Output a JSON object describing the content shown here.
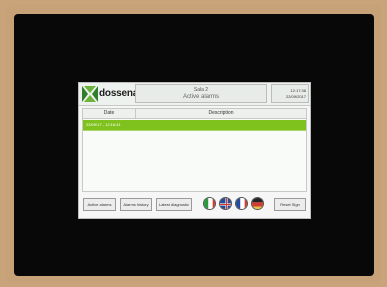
{
  "header": {
    "brand": "dossena",
    "room": "Sala 2",
    "page_title": "Active alarms",
    "time": "12:17:38",
    "date": "22/09/2017"
  },
  "table": {
    "columns": [
      "Date",
      "Description"
    ],
    "rows": [
      {
        "date": "22/09/17 - 12:16:41",
        "description": ""
      }
    ]
  },
  "footer": {
    "buttons": [
      "Active alarms",
      "Alarms history",
      "Latest diagnostic"
    ],
    "user_button": "Reset Sign"
  },
  "flags": [
    "italian-flag",
    "english-flag",
    "french-flag",
    "german-flag"
  ],
  "colors": {
    "active_row": "#7fc21e",
    "brand_green": "#2f7d2d"
  }
}
